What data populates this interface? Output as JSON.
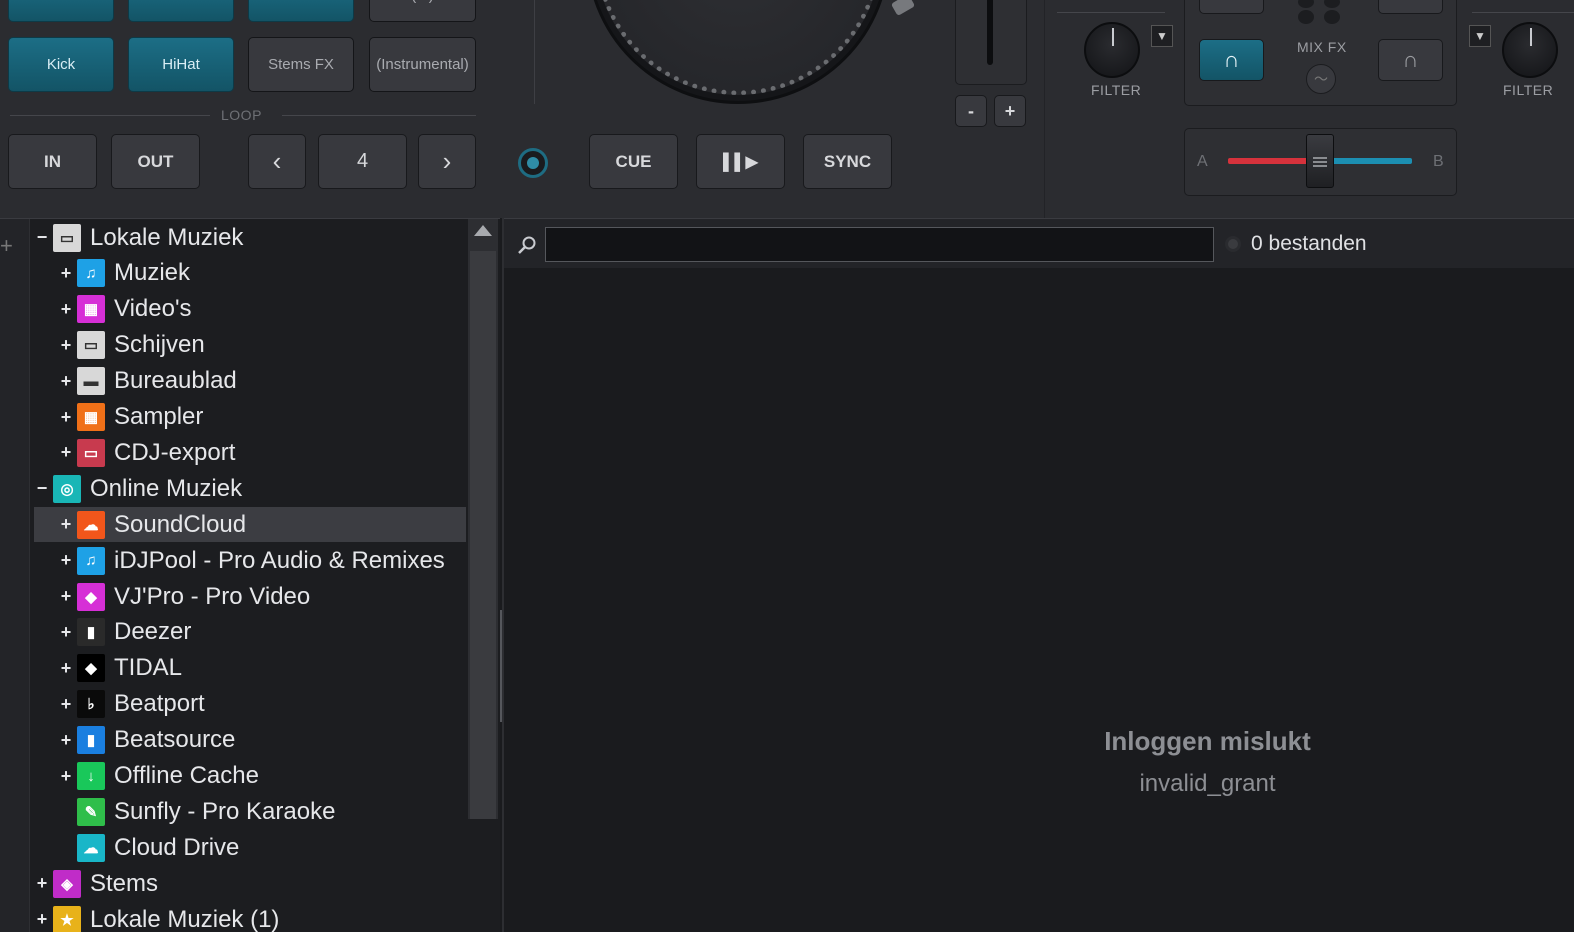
{
  "pads": {
    "kick": "Kick",
    "hihat": "HiHat",
    "stems_fx": "Stems FX",
    "instrumental": "(Instrumental)",
    "top_partial": "(...)"
  },
  "loop": {
    "label": "LOOP",
    "in": "IN",
    "out": "OUT",
    "prev": "‹",
    "size": "4",
    "next": "›"
  },
  "transport": {
    "cue": "CUE",
    "play_pause": "▌▌▶",
    "sync": "SYNC"
  },
  "pitch": {
    "minus": "-",
    "plus": "+"
  },
  "mixer": {
    "filter_left": "FILTER",
    "filter_right": "FILTER",
    "mix_fx": "MIX FX",
    "crossfader_a": "A",
    "crossfader_b": "B",
    "colors": {
      "a": "#d6323c",
      "b": "#1c8fb2"
    }
  },
  "tree": {
    "items": [
      {
        "label": "Lokale Muziek",
        "icon": "monitor-icon",
        "expander": "−",
        "level": 0,
        "color": "#d8d8d8"
      },
      {
        "label": "Muziek",
        "icon": "music-note-icon",
        "expander": "+",
        "level": 1,
        "color": "#1ea1e6"
      },
      {
        "label": "Video's",
        "icon": "film-icon",
        "expander": "+",
        "level": 1,
        "color": "#d62fd6"
      },
      {
        "label": "Schijven",
        "icon": "monitor-icon",
        "expander": "+",
        "level": 1,
        "color": "#d8d8d8"
      },
      {
        "label": "Bureaublad",
        "icon": "desktop-icon",
        "expander": "+",
        "level": 1,
        "color": "#d8d8d8"
      },
      {
        "label": "Sampler",
        "icon": "grid-icon",
        "expander": "+",
        "level": 1,
        "color": "#f07018"
      },
      {
        "label": "CDJ-export",
        "icon": "usb-icon",
        "expander": "+",
        "level": 1,
        "color": "#c83a4e"
      },
      {
        "label": "Online Muziek",
        "icon": "globe-icon",
        "expander": "−",
        "level": 0,
        "color": "#19b6b6"
      },
      {
        "label": "SoundCloud",
        "icon": "soundcloud-icon",
        "expander": "+",
        "level": 1,
        "color": "#f2561b",
        "selected": true
      },
      {
        "label": "iDJPool - Pro Audio & Remixes",
        "icon": "music-note-icon",
        "expander": "+",
        "level": 1,
        "color": "#1ea1e6"
      },
      {
        "label": "VJ'Pro - Pro Video",
        "icon": "vjpro-icon",
        "expander": "+",
        "level": 1,
        "color": "#d62fd6"
      },
      {
        "label": "Deezer",
        "icon": "deezer-icon",
        "expander": "+",
        "level": 1,
        "color": "#2a2a2a"
      },
      {
        "label": "TIDAL",
        "icon": "tidal-icon",
        "expander": "+",
        "level": 1,
        "color": "#000000"
      },
      {
        "label": "Beatport",
        "icon": "beatport-icon",
        "expander": "+",
        "level": 1,
        "color": "#0a0a0a"
      },
      {
        "label": "Beatsource",
        "icon": "beatsource-icon",
        "expander": "+",
        "level": 1,
        "color": "#1a7fe0"
      },
      {
        "label": "Offline Cache",
        "icon": "cache-icon",
        "expander": "+",
        "level": 1,
        "color": "#19c85a"
      },
      {
        "label": "Sunfly - Pro Karaoke",
        "icon": "microphone-icon",
        "expander": "",
        "level": 1,
        "color": "#2fbe4a"
      },
      {
        "label": "Cloud Drive",
        "icon": "cloud-icon",
        "expander": "",
        "level": 1,
        "color": "#19b6c8"
      },
      {
        "label": "Stems",
        "icon": "stems-icon",
        "expander": "+",
        "level": 0,
        "color": "#c02cc8"
      },
      {
        "label": "Lokale Muziek (1)",
        "icon": "star-folder-icon",
        "expander": "+",
        "level": 0,
        "color": "#e8b21a"
      }
    ]
  },
  "folders_tab": "folders",
  "search": {
    "value": "",
    "placeholder": ""
  },
  "file_count": "0 bestanden",
  "login": {
    "title": "Inloggen mislukt",
    "message": "invalid_grant"
  }
}
